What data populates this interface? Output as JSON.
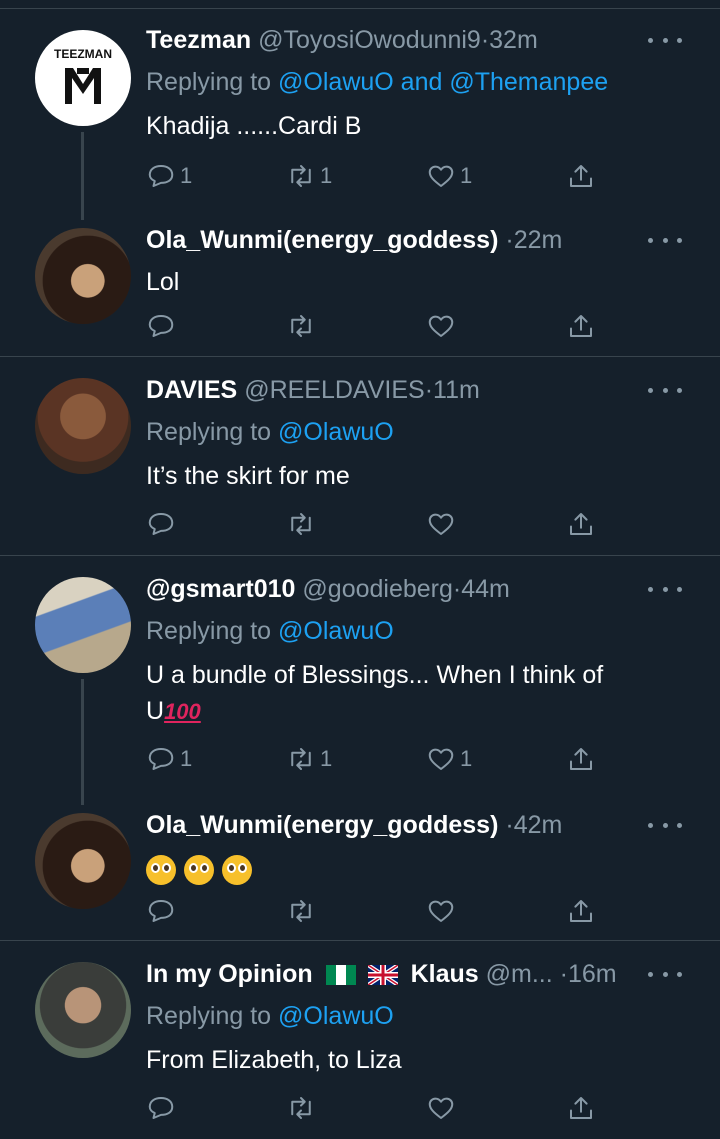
{
  "tweets": [
    {
      "name": "Teezman",
      "handle": "@ToyosiOwodunni9",
      "time": "32m",
      "reply_prefix": "Replying to",
      "reply_mentions": [
        "@OlawuO",
        "and",
        "@Themanpee"
      ],
      "text": "Khadija ......Cardi B",
      "replies": "1",
      "retweets": "1",
      "likes": "1",
      "avatar_logo_text": "TEEZMAN"
    },
    {
      "name": "Ola_Wunmi(energy_goddess)",
      "handle": "",
      "time": "22m",
      "text": "Lol"
    },
    {
      "name": "DAVIES",
      "handle": "@REELDAVIES",
      "time": "11m",
      "reply_prefix": "Replying to",
      "reply_mention": "@OlawuO",
      "text": "It’s the skirt for me"
    },
    {
      "name": "@gsmart010",
      "handle": "@goodieberg",
      "time": "44m",
      "reply_prefix": "Replying to",
      "reply_mention": "@OlawuO",
      "text_line1": "U a bundle of Blessings... When I think of",
      "text_line2": "U",
      "hundred_emoji": "100",
      "replies": "1",
      "retweets": "1",
      "likes": "1"
    },
    {
      "name": "Ola_Wunmi(energy_goddess)",
      "handle": "",
      "time": "42m",
      "emoji_names": [
        "pleading-face-emoji",
        "pleading-face-emoji",
        "pleading-face-emoji"
      ]
    },
    {
      "name_part1": "In my Opinion",
      "name_part2": "Klaus",
      "flags": [
        "nigeria-flag",
        "uk-flag"
      ],
      "handle": "@m...",
      "time": "16m",
      "reply_prefix": "Replying to",
      "reply_mention": "@OlawuO",
      "text": "From Elizabeth,  to Liza"
    }
  ],
  "separator": "·",
  "colors": {
    "background": "#15202b",
    "secondary_text": "#8899a6",
    "link": "#1da1f2",
    "divider": "#38444d"
  },
  "icons": [
    "reply-icon",
    "retweet-icon",
    "like-icon",
    "share-icon",
    "more-icon"
  ]
}
